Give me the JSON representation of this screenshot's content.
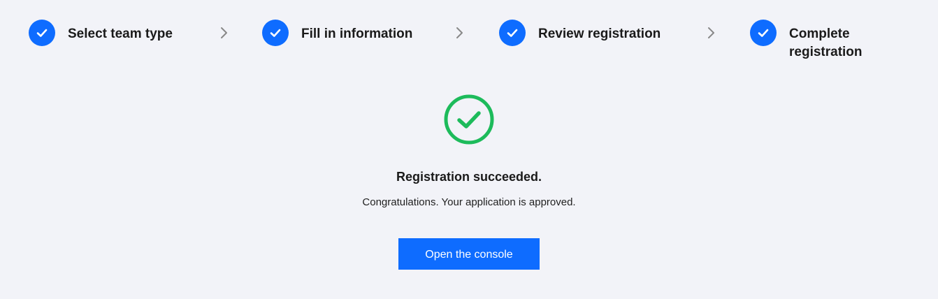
{
  "steps": [
    {
      "label": "Select team type",
      "status": "done",
      "icon": "check-icon"
    },
    {
      "label": "Fill in information",
      "status": "done",
      "icon": "check-icon"
    },
    {
      "label": "Review registration",
      "status": "done",
      "icon": "check-icon"
    },
    {
      "label": "Complete\nregistration",
      "status": "done",
      "icon": "check-icon"
    }
  ],
  "separator_icon": "chevron-right-icon",
  "result": {
    "icon": "success-check-circle-icon",
    "title": "Registration succeeded.",
    "description": "Congratulations. Your application is approved.",
    "button_label": "Open the console"
  },
  "colors": {
    "background": "#f2f3f8",
    "primary": "#0e6cff",
    "success": "#1dbb5b",
    "separator": "#888888"
  }
}
